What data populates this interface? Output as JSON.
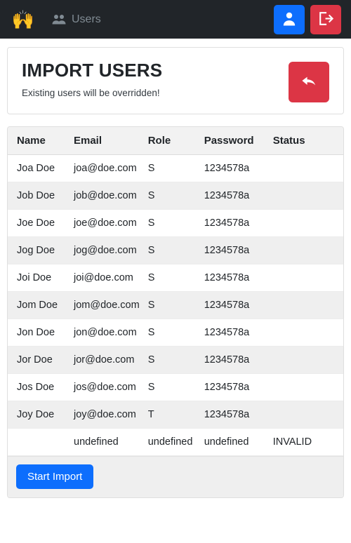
{
  "navbar": {
    "brand_icon": "raising-hands-emoji",
    "brand_glyph": "🙌",
    "users_link_label": "Users",
    "users_link_icon": "users-group-icon",
    "account_button_icon": "person-icon",
    "logout_button_icon": "sign-out-icon",
    "background_color": "#212529",
    "account_button_color": "#0d6efd",
    "logout_button_color": "#dc3545"
  },
  "header": {
    "title": "IMPORT USERS",
    "subtitle": "Existing users will be overridden!",
    "back_button_icon": "reply-arrow-icon",
    "back_button_color": "#dc3545"
  },
  "table": {
    "columns": [
      "Name",
      "Email",
      "Role",
      "Password",
      "Status"
    ],
    "rows": [
      {
        "name": "Joa Doe",
        "email": "joa@doe.com",
        "role": "S",
        "password": "1234578a",
        "status": ""
      },
      {
        "name": "Job Doe",
        "email": "job@doe.com",
        "role": "S",
        "password": "1234578a",
        "status": ""
      },
      {
        "name": "Joe Doe",
        "email": "joe@doe.com",
        "role": "S",
        "password": "1234578a",
        "status": ""
      },
      {
        "name": "Jog Doe",
        "email": "jog@doe.com",
        "role": "S",
        "password": "1234578a",
        "status": ""
      },
      {
        "name": "Joi Doe",
        "email": "joi@doe.com",
        "role": "S",
        "password": "1234578a",
        "status": ""
      },
      {
        "name": "Jom Doe",
        "email": "jom@doe.com",
        "role": "S",
        "password": "1234578a",
        "status": ""
      },
      {
        "name": "Jon Doe",
        "email": "jon@doe.com",
        "role": "S",
        "password": "1234578a",
        "status": ""
      },
      {
        "name": "Jor Doe",
        "email": "jor@doe.com",
        "role": "S",
        "password": "1234578a",
        "status": ""
      },
      {
        "name": "Jos Doe",
        "email": "jos@doe.com",
        "role": "S",
        "password": "1234578a",
        "status": ""
      },
      {
        "name": "Joy Doe",
        "email": "joy@doe.com",
        "role": "T",
        "password": "1234578a",
        "status": ""
      },
      {
        "name": "",
        "email": "undefined",
        "role": "undefined",
        "password": "undefined",
        "status": "INVALID"
      }
    ]
  },
  "footer": {
    "start_import_label": "Start Import",
    "start_import_color": "#0d6efd"
  }
}
